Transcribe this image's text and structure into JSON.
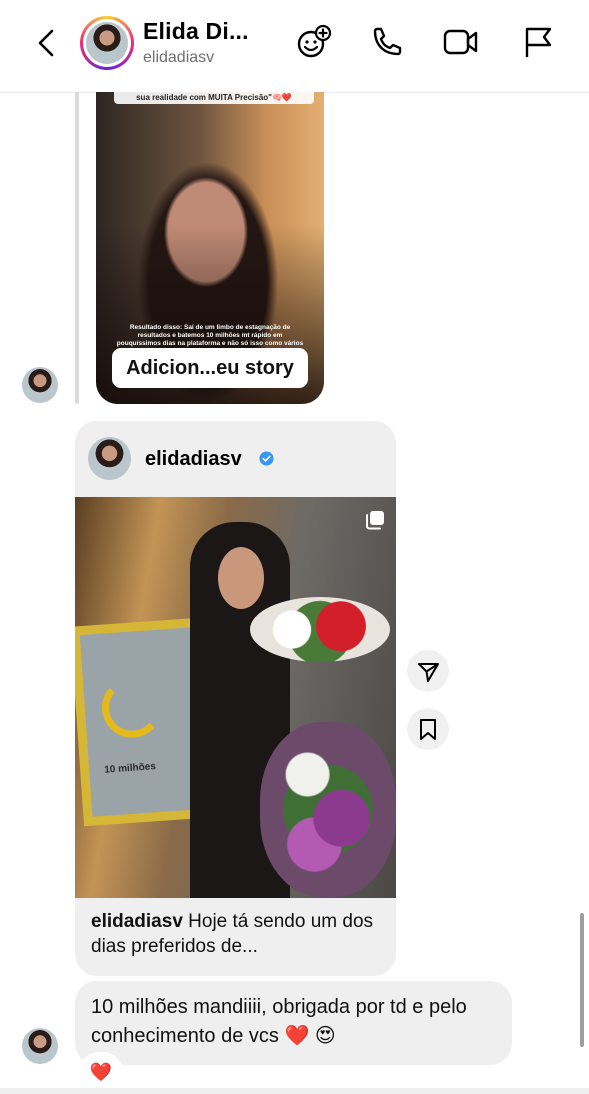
{
  "header": {
    "name": "Elida Di...",
    "username": "elidadiasv",
    "icons": [
      "back-icon",
      "add-effect-icon",
      "phone-icon",
      "video-icon",
      "flag-icon"
    ]
  },
  "story_reply": {
    "top_text": "sua realidade com MUITA Precisão\"🧠❤️",
    "caption_text": "Resultado disso: Saí de um limbo de estagnação de resultados e batemos 10 milhões mt rápido em pouquíssimos dias na plataforma e não só isso como vários acontecimentos",
    "button_label": "Adicion...eu story"
  },
  "shared_post": {
    "username": "elidadiasv",
    "caption_user": "elidadiasv",
    "caption_text": "Hoje tá sendo um dos dias preferidos de...",
    "frame_text": "10 milhões"
  },
  "message": {
    "text": "10 milhões mandiiii, obrigada por td e pelo conhecimento de vcs ❤️ 😍",
    "reaction": "❤️"
  },
  "colors": {
    "verified_blue": "#3897f0",
    "bubble_gray": "#efefef",
    "muted_text": "#6e6e6e"
  }
}
